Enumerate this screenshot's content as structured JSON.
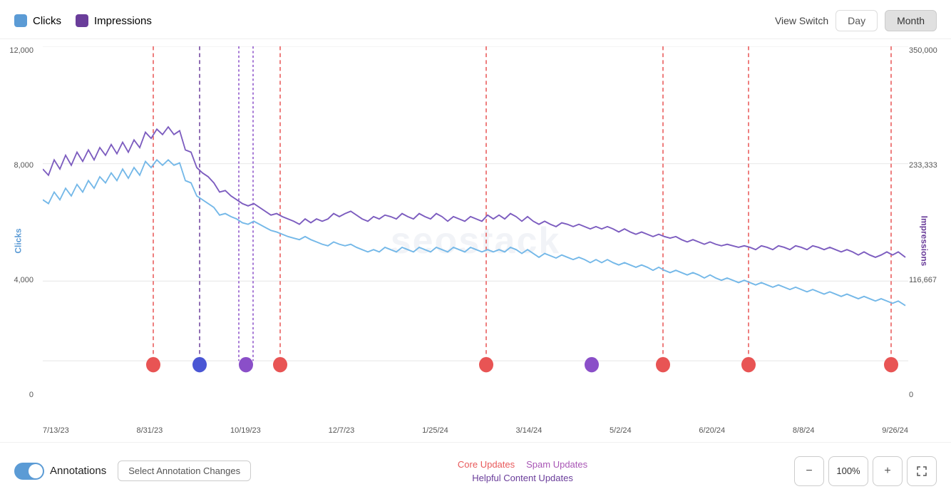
{
  "header": {
    "legend": [
      {
        "key": "clicks",
        "label": "Clicks",
        "color": "#5b9bd5"
      },
      {
        "key": "impressions",
        "label": "Impressions",
        "color": "#6a3d9a"
      }
    ],
    "view_switch_label": "View Switch",
    "btn_day": "Day",
    "btn_month": "Month"
  },
  "chart": {
    "y_left_labels": [
      "12,000",
      "8,000",
      "4,000",
      "0"
    ],
    "y_left_title": "Clicks",
    "y_right_labels": [
      "350,000",
      "233,333",
      "116,667",
      "0"
    ],
    "y_right_title": "Impressions",
    "x_labels": [
      "7/13/23",
      "8/31/23",
      "10/19/23",
      "12/7/23",
      "1/25/24",
      "3/14/24",
      "5/2/24",
      "6/20/24",
      "8/8/24",
      "9/26/24"
    ],
    "watermark": "seostack"
  },
  "bottom_bar": {
    "toggle_label": "Annotations",
    "select_label": "Select Annotation Changes",
    "legend_core": "Core Updates",
    "legend_spam": "Spam Updates",
    "legend_helpful": "Helpful Content Updates",
    "zoom_out": "−",
    "zoom_pct": "100%",
    "zoom_in": "+",
    "zoom_fit": "⤢"
  }
}
